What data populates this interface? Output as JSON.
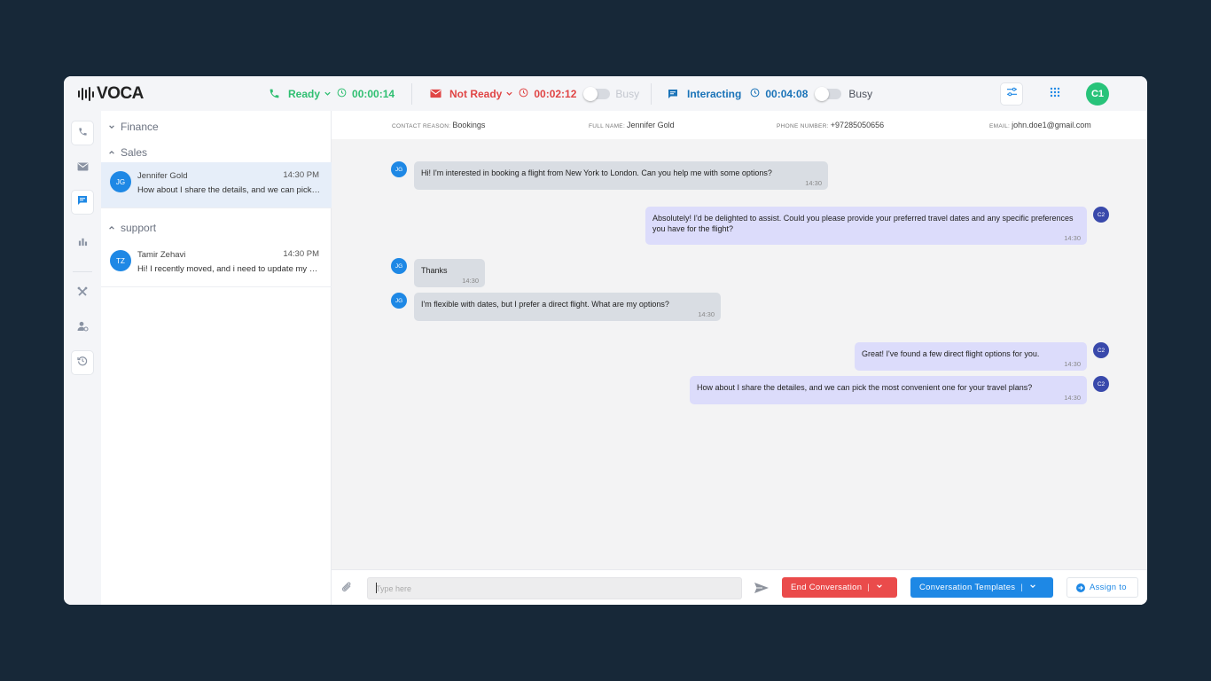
{
  "brand": {
    "logo_text": "VOCA"
  },
  "topbar": {
    "voice": {
      "status": "Ready",
      "timer": "00:00:14",
      "color": "#2fbf71"
    },
    "email": {
      "status": "Not Ready",
      "timer": "00:02:12",
      "busy_label": "Busy",
      "color": "#e04545"
    },
    "chat": {
      "status": "Interacting",
      "timer": "00:04:08",
      "busy_label": "Busy",
      "color": "#1a73b8"
    },
    "user_initials": "C1"
  },
  "rail": {
    "icons": [
      "phone-icon",
      "mail-icon",
      "chat-icon",
      "bar-chart-icon",
      "tools-icon",
      "user-settings-icon",
      "history-icon"
    ],
    "active": "chat-icon"
  },
  "conversations": {
    "groups": [
      {
        "label": "Finance",
        "expanded": false
      },
      {
        "label": "Sales",
        "expanded": true
      },
      {
        "label": "support",
        "expanded": true
      }
    ],
    "items": [
      {
        "group": "Sales",
        "initials": "JG",
        "name": "Jennifer Gold",
        "time": "14:30 PM",
        "preview": "How about I share the details, and we can pick the most convenient one for your travel plans?",
        "active": true
      },
      {
        "group": "support",
        "initials": "TZ",
        "name": "Tamir Zehavi",
        "time": "14:30 PM",
        "preview": "Hi! I recently moved, and i need to update my address",
        "active": false
      }
    ]
  },
  "contact": {
    "reason_label": "CONTACT REASON:",
    "reason": "Bookings",
    "name_label": "FULL NAME:",
    "name": "Jennifer Gold",
    "phone_label": "PHONE NUMBER:",
    "phone": "+97285050656",
    "email_label": "EMAIL:",
    "email": "john.doe1@gmail.com"
  },
  "messages": [
    {
      "from": "customer",
      "initials": "JG",
      "text": "Hi! I'm interested in booking a flight from New York to London. Can you help me with some options?",
      "time": "14:30"
    },
    {
      "from": "agent",
      "initials": "C2",
      "text": "Absolutely! I'd be delighted to assist. Could you please provide your preferred travel dates and any specific preferences you have for the flight?",
      "time": "14:30"
    },
    {
      "from": "customer",
      "initials": "JG",
      "text": "Thanks",
      "time": "14:30"
    },
    {
      "from": "customer",
      "initials": "JG",
      "text": "I'm flexible with dates, but I prefer a direct flight. What are my options?",
      "time": "14:30"
    },
    {
      "from": "agent",
      "initials": "C2",
      "text": "Great! I've found a few direct flight options for you.",
      "time": "14:30"
    },
    {
      "from": "agent",
      "initials": "C2",
      "text": "How about I share the detailes, and we can pick the most convenient one for your travel plans?",
      "time": "14:30"
    }
  ],
  "composer": {
    "placeholder": "Type here",
    "end_label": "End Conversation",
    "templates_label": "Conversation Templates",
    "assign_label": "Assign to"
  }
}
